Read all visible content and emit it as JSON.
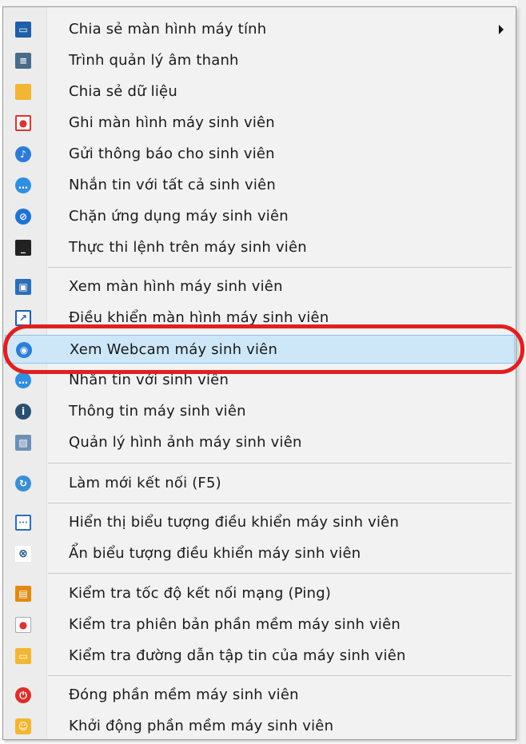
{
  "menu": {
    "items": [
      {
        "label": "Chia sẻ màn hình máy tính",
        "icon": "share-screen-icon",
        "glyph": "▭",
        "has_submenu": true
      },
      {
        "label": "Trình quản lý âm thanh",
        "icon": "audio-manager-icon",
        "glyph": "≡"
      },
      {
        "label": "Chia sẻ dữ liệu",
        "icon": "folder-share-icon",
        "glyph": ""
      },
      {
        "label": "Ghi màn hình máy sinh viên",
        "icon": "screen-record-icon",
        "glyph": "●"
      },
      {
        "label": "Gửi thông báo cho sinh viên",
        "icon": "broadcast-icon",
        "glyph": "♪"
      },
      {
        "label": "Nhắn tin với tất cả sinh viên",
        "icon": "chat-all-icon",
        "glyph": "…"
      },
      {
        "label": "Chặn ứng dụng máy sinh viên",
        "icon": "block-app-icon",
        "glyph": "⊘"
      },
      {
        "label": "Thực thi lệnh trên máy sinh viên",
        "icon": "command-icon",
        "glyph": "_"
      },
      {
        "label": "Xem màn hình máy sinh viên",
        "icon": "view-screen-icon",
        "glyph": "▣"
      },
      {
        "label": "Điều khiển màn hình máy sinh viên",
        "icon": "remote-control-icon",
        "glyph": "↗"
      },
      {
        "label": "Xem Webcam máy sinh viên",
        "icon": "webcam-icon",
        "glyph": "◉",
        "highlighted": true
      },
      {
        "label": "Nhắn tin với sinh viên",
        "icon": "chat-icon",
        "glyph": "…"
      },
      {
        "label": "Thông tin máy sinh viên",
        "icon": "info-icon",
        "glyph": "i"
      },
      {
        "label": "Quản lý hình ảnh máy sinh viên",
        "icon": "image-manager-icon",
        "glyph": "▨"
      },
      {
        "label": "Làm mới kết nối (F5)",
        "icon": "refresh-icon",
        "glyph": "↻"
      },
      {
        "label": "Hiển thị biểu tượng điều khiển máy sinh viên",
        "icon": "show-toolbar-icon",
        "glyph": "···"
      },
      {
        "label": "Ẩn biểu tượng điều khiển máy sinh viên",
        "icon": "hide-icon",
        "glyph": "⊗"
      },
      {
        "label": "Kiểm tra tốc độ kết nối mạng (Ping)",
        "icon": "ping-icon",
        "glyph": "▤"
      },
      {
        "label": "Kiểm tra phiên bản phần mềm máy sinh viên",
        "icon": "version-check-icon",
        "glyph": "●"
      },
      {
        "label": "Kiểm tra đường dẫn tập tin của máy sinh viên",
        "icon": "file-path-icon",
        "glyph": "▭"
      },
      {
        "label": "Đóng phần mềm máy sinh viên",
        "icon": "power-icon",
        "glyph": "⏻"
      },
      {
        "label": "Khởi động phần mềm máy sinh viên",
        "icon": "start-app-icon",
        "glyph": "☺"
      }
    ]
  },
  "colors": {
    "highlight_bg": "#cde7f8",
    "annotation_ring": "#e02020"
  }
}
